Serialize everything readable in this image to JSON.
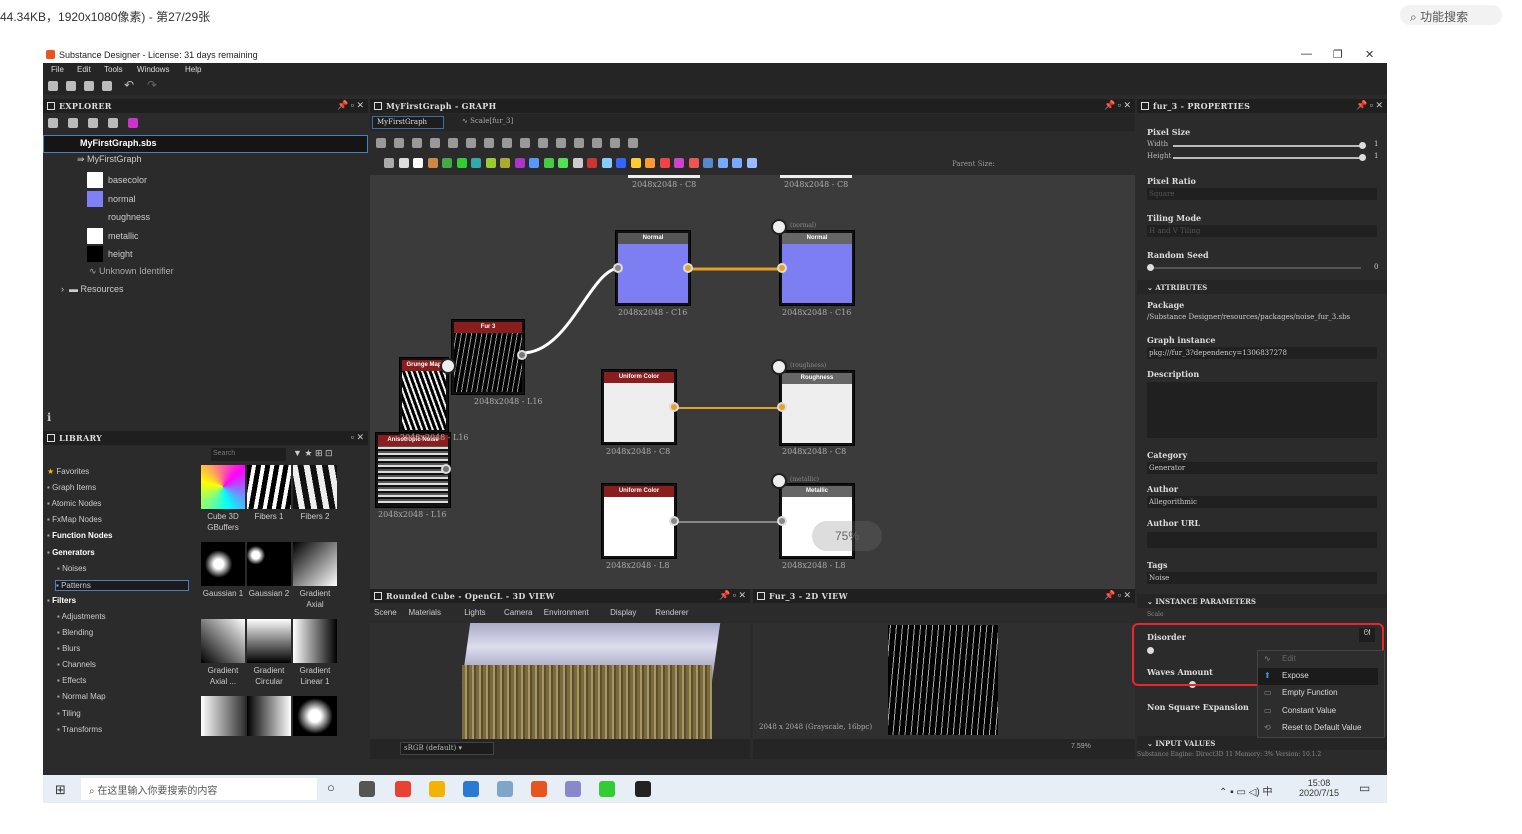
{
  "viewer": {
    "info": "44.34KB，1920x1080像素) - 第27/29张",
    "search": "功能搜索"
  },
  "app": {
    "title": "Substance Designer - License: 31 days remaining",
    "menu": [
      "File",
      "Edit",
      "Tools",
      "Windows",
      "Help"
    ]
  },
  "explorer": {
    "header": "EXPLORER",
    "file": "MyFirstGraph.sbs",
    "graph": "MyFirstGraph",
    "outputs": [
      {
        "label": "basecolor",
        "color": "#ffffff"
      },
      {
        "label": "normal",
        "color": "#7f7ff7"
      },
      {
        "label": "roughness",
        "color": ""
      },
      {
        "label": "metallic",
        "color": "#ffffff"
      },
      {
        "label": "height",
        "color": "#000000"
      }
    ],
    "unknown": "Unknown Identifier",
    "resources": "Resources"
  },
  "library": {
    "header": "LIBRARY",
    "search_placeholder": "Search",
    "categories": [
      "Favorites",
      "Graph Items",
      "Atomic Nodes",
      "FxMap Nodes",
      "Function Nodes",
      "Generators",
      "Noises",
      "Patterns",
      "Filters",
      "Adjustments",
      "Blending",
      "Blurs",
      "Channels",
      "Effects",
      "Normal Map",
      "Tiling",
      "Transforms"
    ],
    "thumbs": [
      [
        "Cube 3D GBuffers",
        "Fibers 1",
        "Fibers 2"
      ],
      [
        "Gaussian 1",
        "Gaussian 2",
        "Gradient Axial"
      ],
      [
        "Gradient Axial ...",
        "Gradient Circular",
        "Gradient Linear 1"
      ]
    ]
  },
  "graph": {
    "header": "MyFirstGraph - GRAPH",
    "tabs": [
      "MyFirstGraph",
      "Scale[fur_3]"
    ],
    "parent_size": "Parent Size:",
    "top_labels": [
      "2048x2048 - C8",
      "2048x2048 - C8"
    ],
    "nodes": {
      "grunge": {
        "title": "Grunge Map",
        "size": ""
      },
      "fur": {
        "title": "Fur 3",
        "size": "2048x2048 - L16"
      },
      "aniso": {
        "title": "Anisotropic Noise",
        "size": "2048x2048 - L16"
      },
      "normal": {
        "title": "Normal",
        "size": "2048x2048 - C16"
      },
      "normal_out": {
        "title": "Normal",
        "tag": "(normal)",
        "size": "2048x2048 - C16"
      },
      "uniform1": {
        "title": "Uniform Color",
        "size": "2048x2048 - C8"
      },
      "rough_out": {
        "title": "Roughness",
        "tag": "(roughness)",
        "size": "2048x2048 - C8"
      },
      "uniform2": {
        "title": "Uniform Color",
        "size": "2048x2048 - L8"
      },
      "metal_out": {
        "title": "Metallic",
        "tag": "(metallic)",
        "size": "2048x2048 - L8"
      }
    },
    "overlay_pct": "75%",
    "hidden_size": "2048x2048 - L16"
  },
  "view3d": {
    "header": "Rounded Cube - OpenGL - 3D VIEW",
    "menu": [
      "Scene",
      "Materials",
      "Lights",
      "Camera",
      "Environment",
      "Display",
      "Renderer"
    ],
    "colorspace": "sRGB (default)"
  },
  "view2d": {
    "header": "Fur_3 - 2D VIEW",
    "info": "2048 x 2048 (Grayscale, 16bpc)",
    "zoom": "7.59%"
  },
  "properties": {
    "header": "fur_3 - PROPERTIES",
    "pixel_size": "Pixel Size",
    "width": "Width",
    "height": "Height",
    "w_val": "1",
    "h_val": "1",
    "pixel_ratio": "Pixel Ratio",
    "pixel_ratio_val": "Square",
    "tiling_mode": "Tiling Mode",
    "tiling_val": "H and V Tiling",
    "random_seed": "Random Seed",
    "seed_val": "0",
    "attributes": "ATTRIBUTES",
    "package": "Package",
    "package_val": "/Substance Designer/resources/packages/noise_fur_3.sbs",
    "graph_instance": "Graph instance",
    "graph_instance_val": "pkg:///fur_3?dependency=1306837278",
    "description": "Description",
    "category": "Category",
    "category_val": "Generator",
    "author": "Author",
    "author_val": "Allegorithmic",
    "author_url": "Author URL",
    "tags": "Tags",
    "tags_val": "Noise",
    "instance_params": "INSTANCE PARAMETERS",
    "scale": "Scale",
    "disorder": "Disorder",
    "waves": "Waves Amount",
    "nonsquare": "Non Square Expansion",
    "input_values": "INPUT VALUES",
    "status": "Substance Engine: Direct3D 11 Memory: 3%    Version: 10.1.2"
  },
  "context_menu": [
    "Edit",
    "Expose",
    "Empty Function",
    "Constant Value",
    "Reset to Default Value"
  ],
  "taskbar": {
    "search": "在这里输入你要搜索的内容",
    "time": "15:08",
    "date": "2020/7/15",
    "ime": "中"
  }
}
